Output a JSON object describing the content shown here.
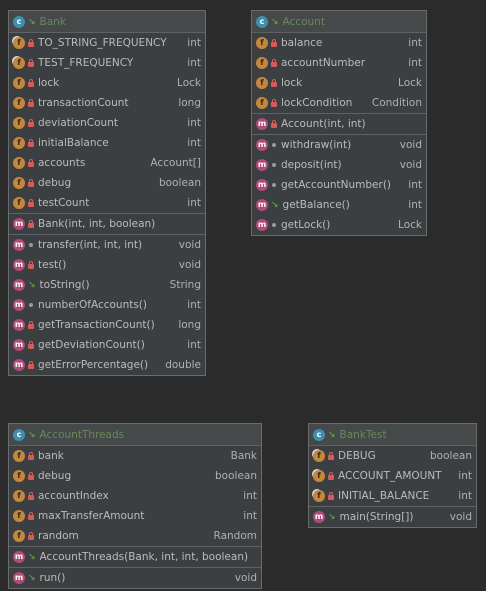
{
  "classes": [
    {
      "name": "Bank",
      "fields": [
        {
          "name": "TO_STRING_FREQUENCY",
          "type": "int",
          "static": true,
          "visibility": "private"
        },
        {
          "name": "TEST_FREQUENCY",
          "type": "int",
          "static": true,
          "visibility": "private"
        },
        {
          "name": "lock",
          "type": "Lock",
          "static": false,
          "visibility": "private"
        },
        {
          "name": "transactionCount",
          "type": "long",
          "static": false,
          "visibility": "private"
        },
        {
          "name": "deviationCount",
          "type": "int",
          "static": false,
          "visibility": "private"
        },
        {
          "name": "initialBalance",
          "type": "int",
          "static": false,
          "visibility": "private"
        },
        {
          "name": "accounts",
          "type": "Account[]",
          "static": false,
          "visibility": "private"
        },
        {
          "name": "debug",
          "type": "boolean",
          "static": false,
          "visibility": "private"
        },
        {
          "name": "testCount",
          "type": "int",
          "static": false,
          "visibility": "private"
        }
      ],
      "constructors": [
        {
          "name": "Bank(int, int, boolean)",
          "type": "",
          "visibility": "private"
        }
      ],
      "methods": [
        {
          "name": "transfer(int, int, int)",
          "type": "void",
          "visibility": "package"
        },
        {
          "name": "test()",
          "type": "void",
          "visibility": "private"
        },
        {
          "name": "toString()",
          "type": "String",
          "visibility": "public"
        },
        {
          "name": "numberOfAccounts()",
          "type": "int",
          "visibility": "package"
        },
        {
          "name": "getTransactionCount()",
          "type": "long",
          "visibility": "private"
        },
        {
          "name": "getDeviationCount()",
          "type": "int",
          "visibility": "private"
        },
        {
          "name": "getErrorPercentage()",
          "type": "double",
          "visibility": "private"
        }
      ]
    },
    {
      "name": "Account",
      "fields": [
        {
          "name": "balance",
          "type": "int",
          "static": false,
          "visibility": "private"
        },
        {
          "name": "accountNumber",
          "type": "int",
          "static": false,
          "visibility": "private"
        },
        {
          "name": "lock",
          "type": "Lock",
          "static": false,
          "visibility": "private"
        },
        {
          "name": "lockCondition",
          "type": "Condition",
          "static": false,
          "visibility": "private"
        }
      ],
      "constructors": [
        {
          "name": "Account(int, int)",
          "type": "",
          "visibility": "private"
        }
      ],
      "methods": [
        {
          "name": "withdraw(int)",
          "type": "void",
          "visibility": "package"
        },
        {
          "name": "deposit(int)",
          "type": "void",
          "visibility": "package"
        },
        {
          "name": "getAccountNumber()",
          "type": "int",
          "visibility": "package"
        },
        {
          "name": "getBalance()",
          "type": "int",
          "visibility": "public"
        },
        {
          "name": "getLock()",
          "type": "Lock",
          "visibility": "package"
        }
      ]
    },
    {
      "name": "AccountThreads",
      "fields": [
        {
          "name": "bank",
          "type": "Bank",
          "static": false,
          "visibility": "private"
        },
        {
          "name": "debug",
          "type": "boolean",
          "static": false,
          "visibility": "private"
        },
        {
          "name": "accountIndex",
          "type": "int",
          "static": false,
          "visibility": "private"
        },
        {
          "name": "maxTransferAmount",
          "type": "int",
          "static": false,
          "visibility": "private"
        },
        {
          "name": "random",
          "type": "Random",
          "static": false,
          "visibility": "private"
        }
      ],
      "constructors": [
        {
          "name": "AccountThreads(Bank, int, int, boolean)",
          "type": "",
          "visibility": "public"
        }
      ],
      "methods": [
        {
          "name": "run()",
          "type": "void",
          "visibility": "public"
        }
      ]
    },
    {
      "name": "BankTest",
      "fields": [
        {
          "name": "DEBUG",
          "type": "boolean",
          "static": true,
          "visibility": "private"
        },
        {
          "name": "ACCOUNT_AMOUNT",
          "type": "int",
          "static": true,
          "visibility": "private"
        },
        {
          "name": "INITIAL_BALANCE",
          "type": "int",
          "static": true,
          "visibility": "private"
        }
      ],
      "constructors": [],
      "methods": [
        {
          "name": "main(String[])",
          "type": "void",
          "visibility": "public",
          "static": true
        }
      ]
    }
  ],
  "icons": {
    "class": "class-icon",
    "field": "field-icon",
    "method": "method-icon",
    "private": "lock-icon",
    "public": "public-icon",
    "package": "package-dot-icon"
  }
}
